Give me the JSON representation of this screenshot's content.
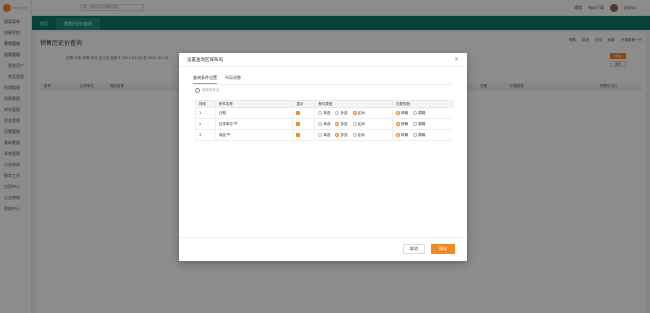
{
  "brand": {
    "logo_text": "EPC 采购平台"
  },
  "sidebar": {
    "items": [
      {
        "label": "搜索菜单"
      },
      {
        "label": "快捷导航"
      },
      {
        "label": "营销管理"
      },
      {
        "label": "权限管理"
      },
      {
        "label": "营销用户"
      },
      {
        "label": "商家管理"
      },
      {
        "label": "检测管理"
      },
      {
        "label": "采购管理"
      },
      {
        "label": "库存管理"
      },
      {
        "label": "资金管理"
      },
      {
        "label": "设置管理"
      },
      {
        "label": "基础数据"
      },
      {
        "label": "系统管理"
      },
      {
        "label": "企业协同"
      },
      {
        "label": "数字工作"
      },
      {
        "label": "应用中心"
      },
      {
        "label": "企业商城"
      },
      {
        "label": "帮助中心"
      }
    ]
  },
  "topbar": {
    "search_placeholder": "输入商品名称/编码搜索",
    "notice_label": "通知",
    "app_label": "App下载",
    "user_name": "jiaoyu"
  },
  "tabs": [
    {
      "label": "首页"
    },
    {
      "label": "销售历史价查询"
    }
  ],
  "page": {
    "title": "销售历史价查询",
    "tools": [
      "帮助",
      "导出",
      "打印",
      "刷新",
      "不搜索第一行"
    ],
    "filter_text": "日期 今天 本周 本月 近三月 自定义 2021-02-18 至 2021-02-24",
    "filter_highlight": "自定义",
    "search_button": "查询",
    "reset_button": "重置",
    "grid_columns": [
      "序号",
      "往来单位",
      "商品名称",
      "日期",
      "价格类型",
      "销售价(元)"
    ]
  },
  "modal": {
    "title": "设置查询区域布局",
    "close": "×",
    "tabs": [
      {
        "label": "查询条件设置",
        "active": true
      },
      {
        "label": "布局调整",
        "active": false
      }
    ],
    "search_placeholder": "搜索条件名",
    "columns": [
      "排序",
      "条件名称",
      "显示",
      "条件类型",
      "匹配规则"
    ],
    "rows": [
      {
        "order": "1",
        "name": "日期",
        "has_arrow": false,
        "type_selected": "区间",
        "match_selected": "精确"
      },
      {
        "order": "2",
        "name": "往来单位",
        "has_arrow": true,
        "type_selected": "多选",
        "match_selected": "精确"
      },
      {
        "order": "3",
        "name": "商品",
        "has_arrow": true,
        "type_selected": "多选",
        "match_selected": "精确"
      }
    ],
    "type_options": [
      "单选",
      "多选",
      "区间"
    ],
    "match_options": [
      "精确",
      "模糊"
    ],
    "cancel_label": "取消",
    "confirm_label": "保存"
  },
  "colors": {
    "accent": "#f08a24",
    "tabbar": "#0a7a6a"
  }
}
